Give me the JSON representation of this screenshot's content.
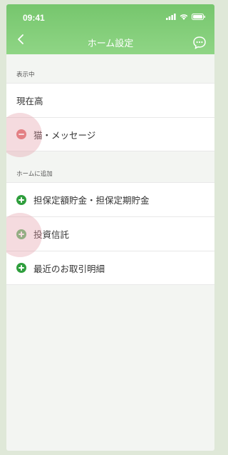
{
  "status_bar": {
    "time": "09:41"
  },
  "nav": {
    "title": "ホーム設定"
  },
  "shown_section": {
    "label": "表示中",
    "items": [
      {
        "label": "現在高"
      },
      {
        "label": "猫・メッセージ"
      }
    ]
  },
  "add_section": {
    "label": "ホームに追加",
    "items": [
      {
        "label": "担保定額貯金・担保定期貯金"
      },
      {
        "label": "投資信託"
      },
      {
        "label": "最近のお取引明細"
      }
    ]
  },
  "icons": {
    "back": "chevron-left-icon",
    "chat": "chat-bubble-icon",
    "remove": "minus-circle-icon",
    "add": "plus-circle-icon",
    "signal": "signal-icon",
    "wifi": "wifi-icon",
    "battery": "battery-icon"
  },
  "colors": {
    "header_green": "#7ccb72",
    "add_icon": "#2f9e3d",
    "remove_icon": "#e36d6d",
    "background": "#f3f5f2"
  }
}
